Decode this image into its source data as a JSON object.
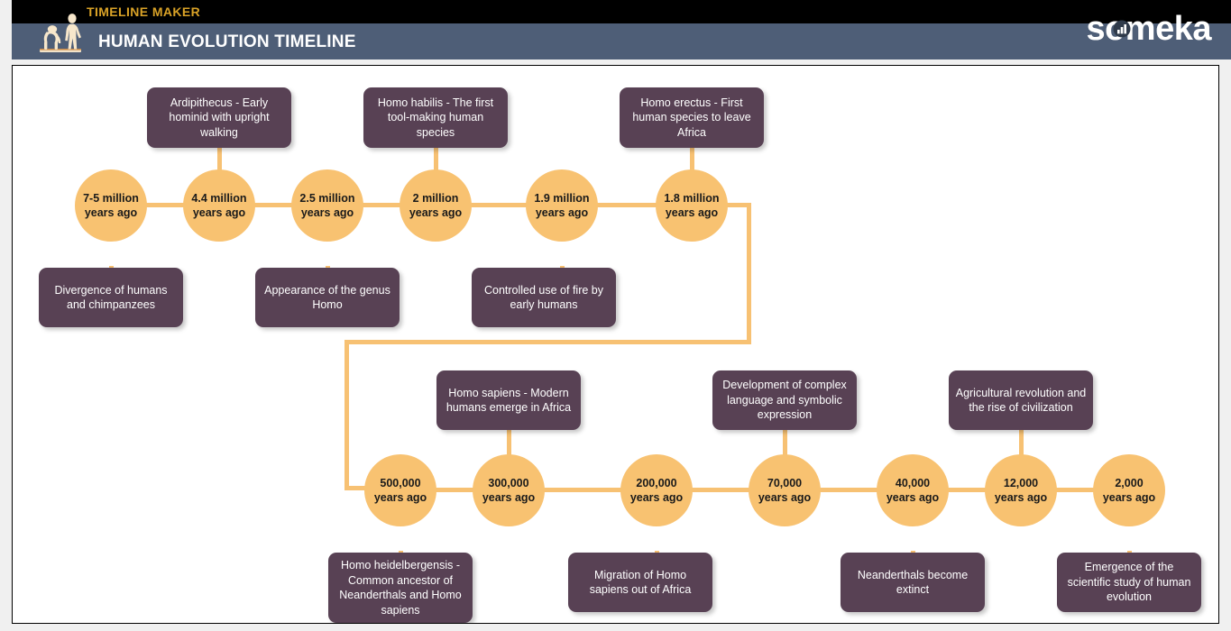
{
  "header": {
    "kicker": "TIMELINE MAKER",
    "title": "HUMAN EVOLUTION TIMELINE",
    "brand": "someka",
    "brand_icon": "bar-chart-icon",
    "logo_icon": "human-evolution-icon",
    "colors": {
      "top_band": "#000000",
      "bottom_band": "#4E5E77",
      "kicker_text": "#D9A227",
      "title_text": "#FFFFFF"
    }
  },
  "theme": {
    "node_fill": "#F8C271",
    "node_text": "#1A1A1A",
    "box_fill": "#584154",
    "box_text": "#FFFFFF",
    "connector": "#F7C173",
    "canvas_bg": "#FFFFFF",
    "page_bg": "#F0F0F0"
  },
  "timeline": {
    "row1": [
      {
        "date_line1": "7-5 million",
        "date_line2": "years ago",
        "label": "Divergence of humans and chimpanzees",
        "label_position": "below"
      },
      {
        "date_line1": "4.4 million",
        "date_line2": "years ago",
        "label": "Ardipithecus - Early hominid with upright walking",
        "label_position": "above"
      },
      {
        "date_line1": "2.5 million",
        "date_line2": "years ago",
        "label": "Appearance of the genus Homo",
        "label_position": "below"
      },
      {
        "date_line1": "2 million",
        "date_line2": "years ago",
        "label": "Homo habilis - The first tool-making human species",
        "label_position": "above"
      },
      {
        "date_line1": "1.9 million",
        "date_line2": "years ago",
        "label": "Controlled use of fire by early humans",
        "label_position": "below"
      },
      {
        "date_line1": "1.8 million",
        "date_line2": "years ago",
        "label": "Homo erectus - First human species to leave Africa",
        "label_position": "above"
      }
    ],
    "row2": [
      {
        "date_line1": "500,000",
        "date_line2": "years ago",
        "label": "Homo heidelbergensis - Common ancestor of Neanderthals and Homo sapiens",
        "label_position": "below"
      },
      {
        "date_line1": "300,000",
        "date_line2": "years ago",
        "label": "Homo sapiens - Modern humans emerge in Africa",
        "label_position": "above"
      },
      {
        "date_line1": "200,000",
        "date_line2": "years ago",
        "label": "Migration of Homo sapiens out of Africa",
        "label_position": "below"
      },
      {
        "date_line1": "70,000",
        "date_line2": "years ago",
        "label": "Development of complex language and symbolic expression",
        "label_position": "above"
      },
      {
        "date_line1": "40,000",
        "date_line2": "years ago",
        "label": "Neanderthals become extinct",
        "label_position": "below"
      },
      {
        "date_line1": "12,000",
        "date_line2": "years ago",
        "label": "Agricultural revolution and the rise of civilization",
        "label_position": "above"
      },
      {
        "date_line1": "2,000",
        "date_line2": "years ago",
        "label": "Emergence of the scientific study of human evolution",
        "label_position": "below"
      }
    ]
  }
}
